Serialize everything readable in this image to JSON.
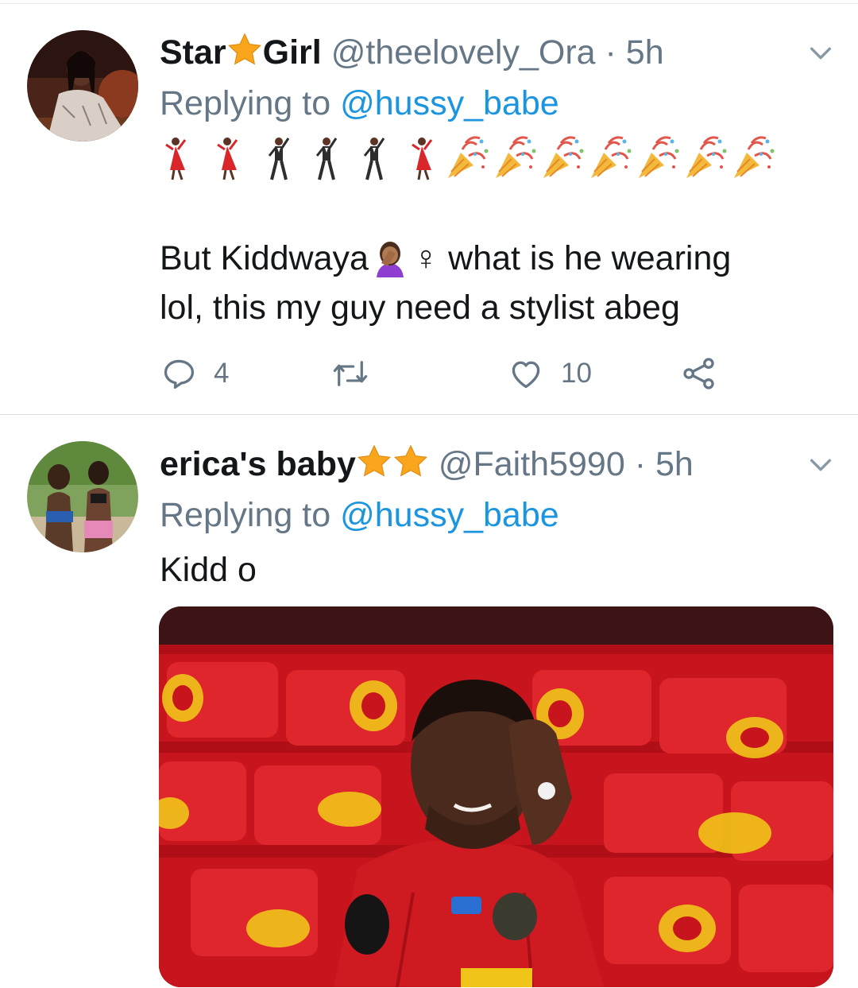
{
  "tweets": [
    {
      "display_name_part1": "Star",
      "display_name_part2": "Girl",
      "handle": "@theelovely_Ora",
      "separator": "·",
      "time": "5h",
      "replying_prefix": "Replying to",
      "replying_user": "@hussy_babe",
      "text_line1_before": "But Kiddwaya",
      "text_line1_after": "♀ what is he wearing",
      "text_line2": "lol, this my guy need a stylist abeg",
      "reply_count": "4",
      "like_count": "10"
    },
    {
      "display_name": "erica's baby",
      "handle": "@Faith5990",
      "separator": "·",
      "time": "5h",
      "replying_prefix": "Replying to",
      "replying_user": "@hussy_babe",
      "text": "Kidd o"
    }
  ],
  "icons": {
    "star": "star-emoji",
    "dancer": "woman-dancing-emoji",
    "man_dancer": "man-dancing-emoji",
    "popper": "party-popper-emoji",
    "facepalm": "woman-facepalming-emoji",
    "chevron": "chevron-down-icon",
    "reply": "reply-icon",
    "retweet": "retweet-icon",
    "like": "heart-icon",
    "share": "share-icon"
  },
  "colors": {
    "link": "#1b95e0",
    "secondary_text": "#657786",
    "star": "#f9a61c"
  }
}
